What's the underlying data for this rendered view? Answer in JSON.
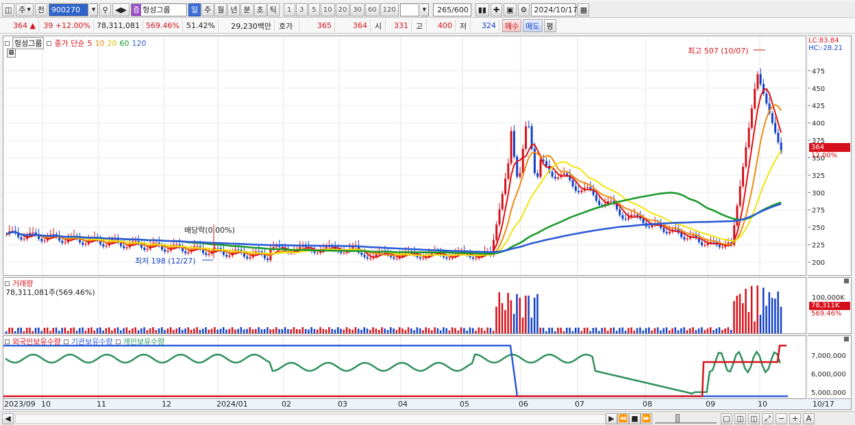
{
  "toolbar": {
    "type_label": "주",
    "prev_label": "전",
    "code": "900270",
    "name_badge": "증",
    "name": "헝성그룹",
    "periods": [
      "일",
      "주",
      "월",
      "년",
      "분",
      "초",
      "틱"
    ],
    "selected_period": "일",
    "intervals": [
      "1",
      "3",
      "5",
      "10",
      "20",
      "30",
      "60",
      "120"
    ],
    "count": "265",
    "count_total": "/600",
    "date": "2024/10/17"
  },
  "quote": {
    "price": "364",
    "arrow": "▲",
    "change": "39",
    "change_pct": "+12.00%",
    "volume": "78,311,081",
    "volume_pct": "569.46%",
    "turnover": "51.42%",
    "amount": "29,230백만",
    "hoga_label": "호가",
    "ask": "365",
    "bid": "364",
    "open_label": "시",
    "open": "331",
    "high_label": "고",
    "high": "400",
    "low_label": "저",
    "low": "324",
    "buy_label": "매수",
    "sell_label": "매도",
    "eval_label": "평"
  },
  "price_pane": {
    "name": "헝성그룹",
    "ma_label": "종가 단순",
    "ma_periods": [
      "5",
      "10",
      "20",
      "60",
      "120"
    ],
    "ma_colors": [
      "#e01010",
      "#ee8a10",
      "#f2e40a",
      "#1c9a2c",
      "#2a5ad8"
    ],
    "lc": "LC:83.84",
    "hc": "HC:-28.21",
    "price_tag": "364",
    "price_pct": "12.00%",
    "max_note": "최고 507 (10/07)",
    "min_note": "최저 198 (12/27)",
    "div_note": "배당락(0.00%)",
    "y_ticks": [
      "475",
      "450",
      "425",
      "400",
      "375",
      "350",
      "325",
      "300",
      "275",
      "250",
      "225",
      "200"
    ]
  },
  "volume_pane": {
    "title": "거래량",
    "value": "78,311,081주(569.46%)",
    "axis_tick": "100,000K",
    "tag": "78,311K",
    "tag_pct": "569.46%"
  },
  "holding_pane": {
    "foreign": "외국인보유수량",
    "inst": "기관보유수량",
    "indiv": "개인보유수량",
    "y_ticks": [
      "7,000,000",
      "6,000,000",
      "5,000,000"
    ]
  },
  "x_axis": [
    "2023/09",
    "10",
    "11",
    "12",
    "2024/01",
    "02",
    "03",
    "04",
    "05",
    "06",
    "07",
    "08",
    "09",
    "10"
  ],
  "x_end": "10/17",
  "colors": {
    "up": "#d6101a",
    "down": "#1140c8",
    "accent": "#2f63c9"
  }
}
